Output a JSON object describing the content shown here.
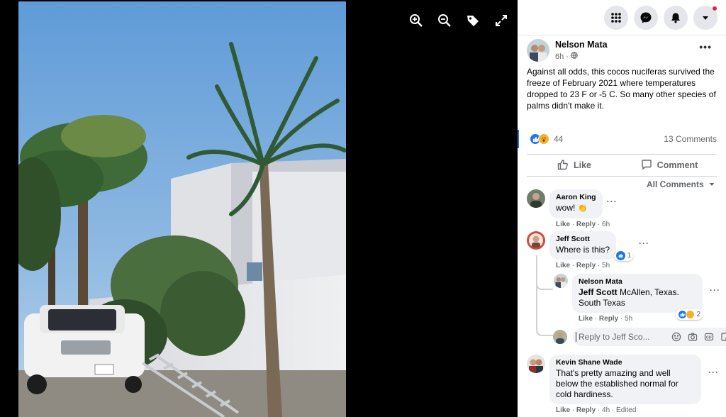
{
  "viewer": {
    "tools": [
      {
        "icon": "zoom-in-icon"
      },
      {
        "icon": "zoom-out-icon"
      },
      {
        "icon": "tag-icon"
      },
      {
        "icon": "fullscreen-icon"
      }
    ]
  },
  "topbar": {
    "buttons": [
      "menu-grid-icon",
      "messenger-icon",
      "notifications-icon",
      "account-dropdown-icon"
    ]
  },
  "post": {
    "author": "Nelson Mata",
    "time": "6h",
    "privacy_icon": "globe-icon",
    "text": "Against all odds, this cocos nuciferas survived the freeze of February 2021 where temperatures dropped to 23 F or -5 C. So many other species of palms didn't make it.",
    "reaction_count": "44",
    "comment_count": "13 Comments",
    "like_label": "Like",
    "comment_label": "Comment",
    "sort_label": "All Comments"
  },
  "comments": {
    "c1": {
      "author": "Aaron King",
      "text": "wow! ",
      "emoji": "👏",
      "like": "Like",
      "reply": "Reply",
      "time": "6h"
    },
    "c2": {
      "author": "Jeff Scott",
      "text": "Where is this?",
      "reactions": "1",
      "like": "Like",
      "reply": "Reply",
      "time": "5h"
    },
    "c3": {
      "author": "Nelson Mata",
      "mention": "Jeff Scott",
      "text": " McAllen, Texas. South Texas",
      "reactions": "2",
      "like": "Like",
      "reply": "Reply",
      "time": "5h"
    },
    "c4": {
      "author": "Kevin Shane Wade",
      "text": "That's pretty amazing and well below the established normal for cold hardiness.",
      "like": "Like",
      "reply": "Reply",
      "time": "4h",
      "edited": "Edited"
    }
  },
  "reply_box": {
    "placeholder": "Reply to Jeff Sco..."
  },
  "colors": {
    "accent": "#1877f2",
    "panel_bg": "#ffffff",
    "bubble_bg": "#f0f2f5",
    "secondary_text": "#65676b",
    "notification_dot": "#e41e3f"
  }
}
